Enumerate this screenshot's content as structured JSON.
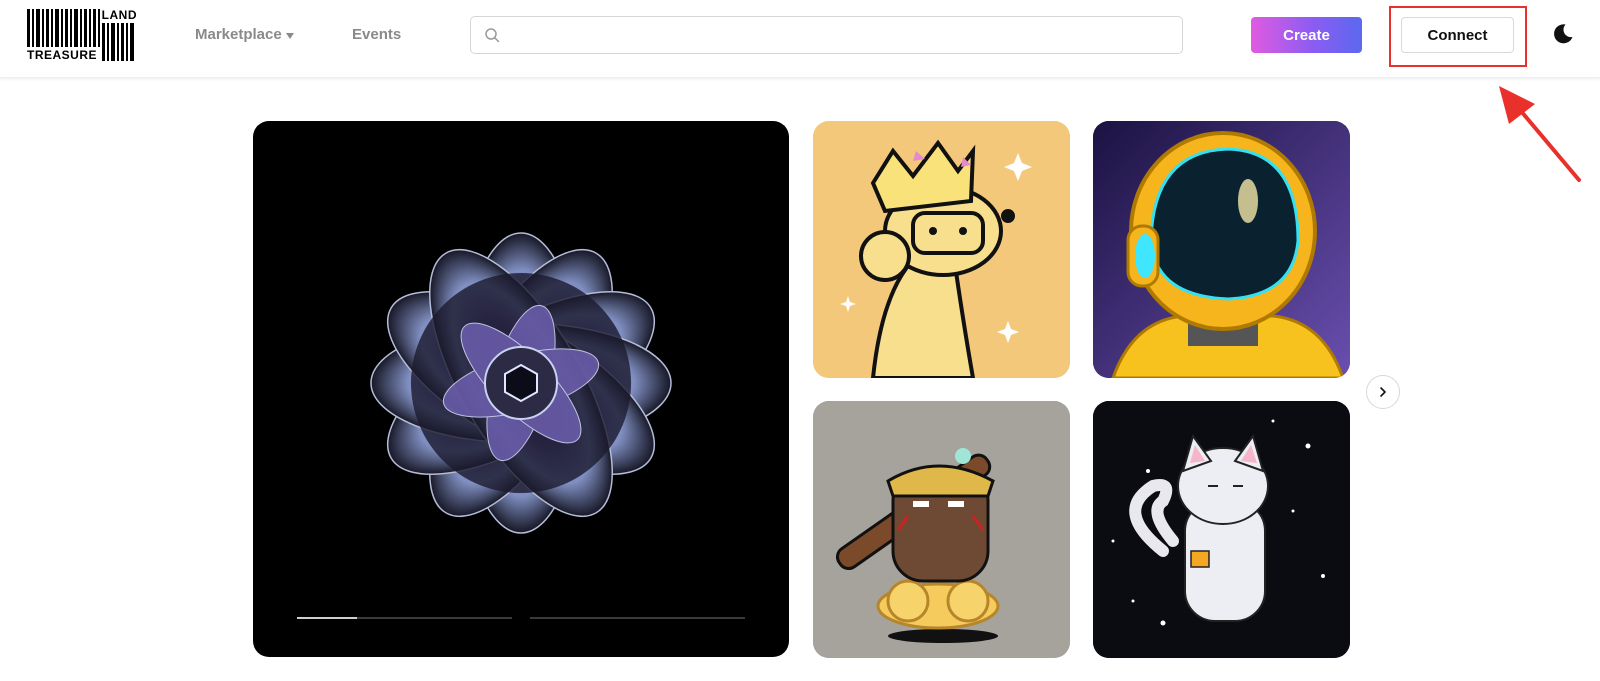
{
  "header": {
    "logo": {
      "top_text": "LAND",
      "bottom_text": "TREASURE"
    },
    "nav": {
      "marketplace_label": "Marketplace",
      "events_label": "Events"
    },
    "search": {
      "placeholder": "",
      "value": ""
    },
    "create_label": "Create",
    "connect_label": "Connect"
  },
  "icons": {
    "search": "search-icon",
    "caret": "caret-down-icon",
    "theme_toggle": "moon-icon",
    "next": "chevron-right-icon",
    "annotation": "red-arrow-icon"
  },
  "colors": {
    "accent_gradient_start": "#e05be0",
    "accent_gradient_end": "#5b68f0",
    "highlight": "#e9302a",
    "nav_text": "#8a8a8a"
  },
  "gallery": {
    "featured": {
      "name": "fractal-artwork",
      "progress": [
        0.28,
        0
      ]
    },
    "tiles": [
      {
        "name": "crowned-llama-artwork"
      },
      {
        "name": "astronaut-helmet-artwork"
      },
      {
        "name": "monkey-king-artwork"
      },
      {
        "name": "space-cat-artwork"
      }
    ]
  }
}
